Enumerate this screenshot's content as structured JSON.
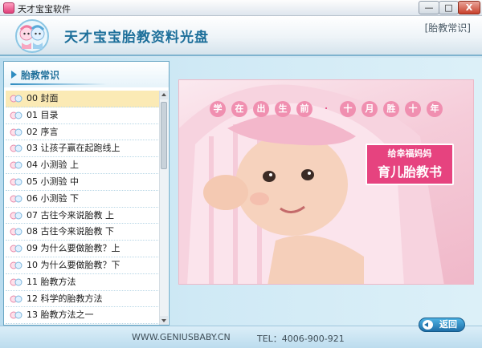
{
  "window": {
    "title": "天才宝宝软件",
    "minimize_label": "—",
    "maximize_label": "□",
    "close_label": "X"
  },
  "header": {
    "title": "天才宝宝胎教资料光盘",
    "section_tag": "[胎教常识]"
  },
  "sidebar": {
    "heading": "胎教常识",
    "selected_index": 0,
    "items": [
      {
        "label": "00 封面"
      },
      {
        "label": "01 目录"
      },
      {
        "label": "02 序言"
      },
      {
        "label": "03 让孩子赢在起跑线上"
      },
      {
        "label": "04 小测验 上"
      },
      {
        "label": "05 小测验 中"
      },
      {
        "label": "06 小测验 下"
      },
      {
        "label": "07 古往今来说胎教 上"
      },
      {
        "label": "08 古往今来说胎教 下"
      },
      {
        "label": "09 为什么要做胎教？上"
      },
      {
        "label": "10  为什么要做胎教？下"
      },
      {
        "label": "11 胎教方法"
      },
      {
        "label": "12 科学的胎教方法"
      },
      {
        "label": "13 胎教方法之一"
      }
    ]
  },
  "content": {
    "slogan": [
      "学",
      "在",
      "出",
      "生",
      "前",
      "·",
      "十",
      "月",
      "胜",
      "十",
      "年"
    ],
    "badge_subtitle": "给幸福妈妈",
    "badge_title": "育儿胎教书"
  },
  "footer": {
    "website": "WWW.GENIUSBABY.CN",
    "phone": "TEL：4006-900-921",
    "back_label": "返回"
  },
  "colors": {
    "accent": "#1d6f9a",
    "pink": "#e6437f",
    "selected_row": "#fbeab5"
  }
}
